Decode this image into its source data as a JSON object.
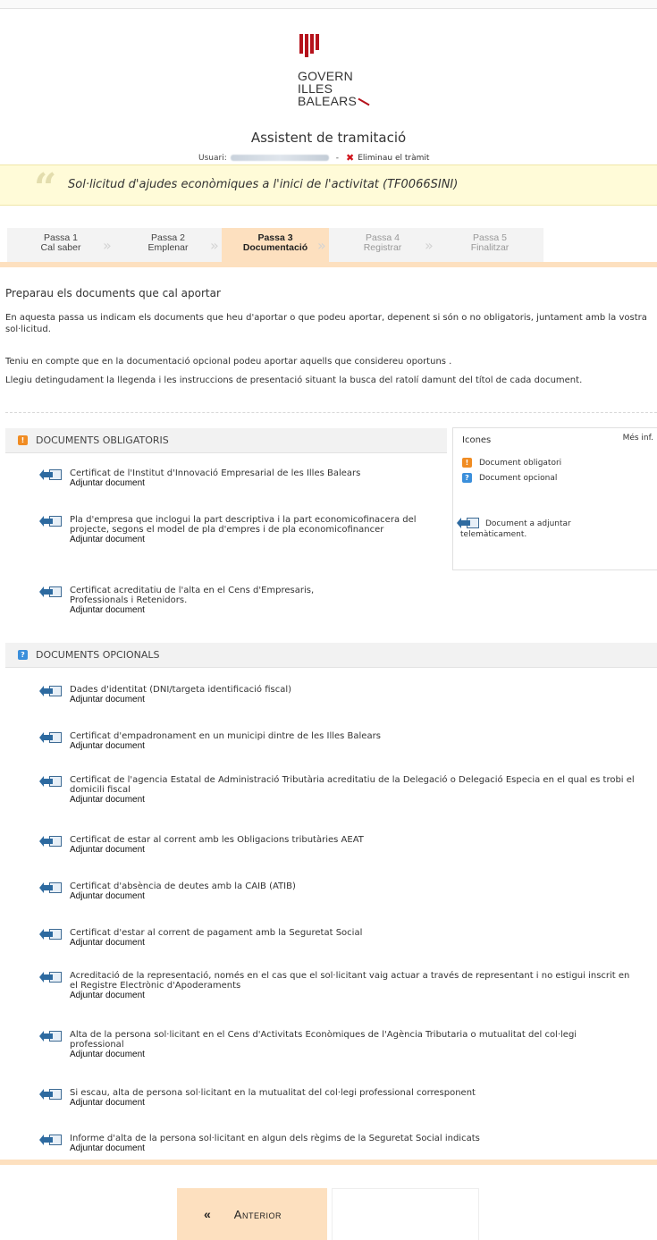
{
  "header": {
    "logo_lines": [
      "GOVERN",
      "ILLES",
      "BALEARS"
    ],
    "app_title": "Assistent de tramitació",
    "user_label": "Usuari:",
    "separator": "-",
    "delete_label": "Eliminau el tràmit"
  },
  "procedure": {
    "title": "Sol·licitud d'ajudes econòmiques a l'inici de l'activitat (TF0066SINI)"
  },
  "steps": [
    {
      "num": "Passa 1",
      "label": "Cal saber",
      "state": "done"
    },
    {
      "num": "Passa 2",
      "label": "Emplenar",
      "state": "done"
    },
    {
      "num": "Passa 3",
      "label": "Documentació",
      "state": "active"
    },
    {
      "num": "Passa 4",
      "label": "Registrar",
      "state": "future"
    },
    {
      "num": "Passa 5",
      "label": "Finalitzar",
      "state": "future"
    }
  ],
  "content": {
    "heading": "Preparau els documents que cal aportar",
    "p1": "En aquesta passa us indicam els documents que heu d'aportar o que podeu aportar, depenent si són o no obligatoris, juntament amb la vostra sol·licitud.",
    "p2": "Teniu en compte que en la documentació opcional podeu aportar aquells que considereu oportuns .",
    "p3": "Llegiu detingudament la llegenda i les instruccions de presentació situant la busca del ratolí damunt del títol de cada document."
  },
  "mandatory": {
    "header": "DOCUMENTS OBLIGATORIS",
    "action_label": "Adjuntar document",
    "docs": [
      "Certificat de l'Institut d'Innovació Empresarial de les Illes Balears",
      "Pla d'empresa que inclogui la part descriptiva i la part economicofinacera del projecte, segons el model de pla d'empres i de pla economicofinancer",
      "Certificat acreditatiu de l'alta en el Cens d'Empresaris, Professionals i Retenidors."
    ]
  },
  "optional": {
    "header": "DOCUMENTS OPCIONALS",
    "action_label": "Adjuntar document",
    "docs": [
      "Dades d'identitat (DNI/targeta identificació fiscal)",
      "Certificat d'empadronament en un municipi dintre de les Illes Balears",
      "Certificat de l'agencia Estatal de Administració Tributària acreditatiu de la Delegació o Delegació Especia en el qual es trobi el domicili fiscal",
      "Certificat de estar al corrent amb les Obligacions tributàries AEAT",
      "Certificat d'absència de deutes amb la CAIB (ATIB)",
      "Certificat d'estar al corrent de pagament amb la Seguretat Social",
      "Acreditació de la representació, només en el cas que el sol·licitant vaig actuar a través de representant i no estigui inscrit en el Registre Electrònic d'Apoderaments",
      "Alta de la persona sol·licitant en el Cens d'Activitats Econòmiques de l'Agència Tributaria o mutualitat del col·legi professional",
      "Si escau, alta de persona sol·licitant en la mutualitat del col·legi professional corresponent",
      "Informe d'alta de la persona sol·licitant en algun dels règims de la Seguretat Social indicats"
    ]
  },
  "legend": {
    "title": "Icones",
    "more": "Més inf.",
    "mandatory": "Document obligatori",
    "optional": "Document opcional",
    "telematic": "Document a adjuntar telemàticament."
  },
  "nav": {
    "prev_label": "Anterior",
    "prev_icon": "chevron-left-icon"
  },
  "colors": {
    "accent": "#fde0bf",
    "banner": "#fffbd8",
    "mandatory": "#f08c23",
    "optional": "#3b8fdb",
    "delete": "#d0141c"
  }
}
